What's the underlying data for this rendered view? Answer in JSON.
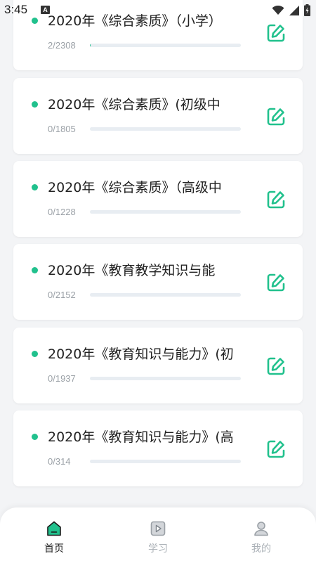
{
  "status_bar": {
    "time": "3:45",
    "notification_badge": "A",
    "icons": [
      "wifi-icon",
      "signal-icon",
      "battery-icon"
    ]
  },
  "colors": {
    "accent": "#21c18d",
    "track": "#e8edf2",
    "background": "#f3f4f6",
    "tab_inactive": "#aab0b6"
  },
  "cards": [
    {
      "title": "2020年《综合素质》（小学）",
      "count": "2/2308",
      "progress": 0.0009
    },
    {
      "title": "2020年《综合素质》(初级中",
      "count": "0/1805",
      "progress": 0
    },
    {
      "title": "2020年《综合素质》（高级中",
      "count": "0/1228",
      "progress": 0
    },
    {
      "title": "2020年《教育教学知识与能",
      "count": "0/2152",
      "progress": 0
    },
    {
      "title": "2020年《教育知识与能力》(初",
      "count": "0/1937",
      "progress": 0
    },
    {
      "title": "2020年《教育知识与能力》(高",
      "count": "0/314",
      "progress": 0
    }
  ],
  "tabbar": {
    "items": [
      {
        "label": "首页",
        "icon": "home-icon",
        "active": true
      },
      {
        "label": "学习",
        "icon": "play-icon",
        "active": false
      },
      {
        "label": "我的",
        "icon": "user-icon",
        "active": false
      }
    ]
  }
}
